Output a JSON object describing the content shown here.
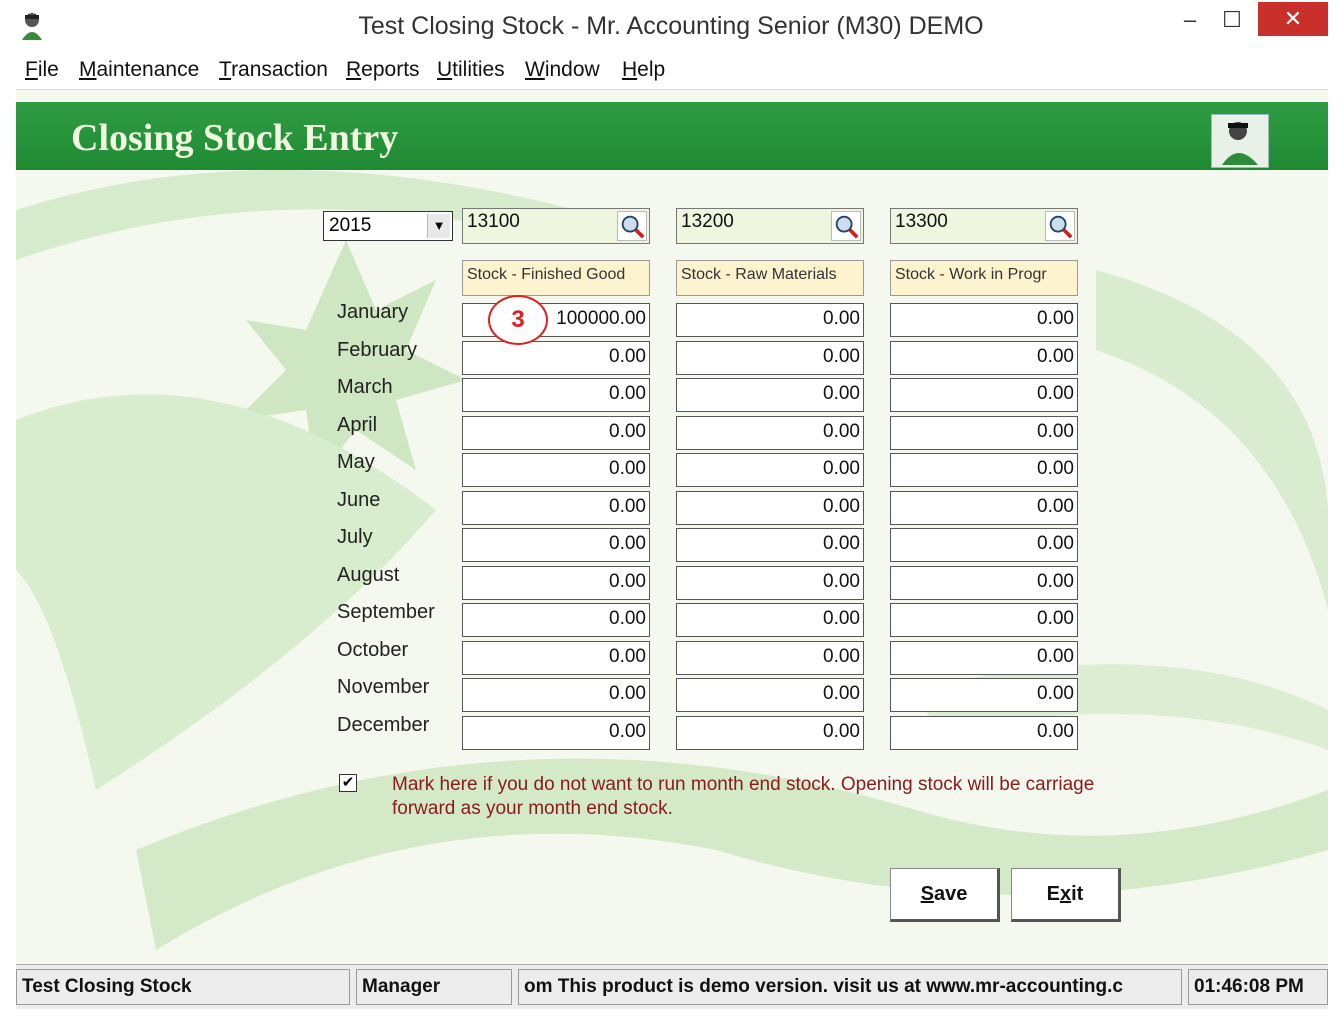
{
  "window": {
    "title": "Test Closing Stock - Mr. Accounting Senior (M30) DEMO",
    "minimize": "–",
    "maximize": "☐",
    "close": "✕"
  },
  "menu": [
    {
      "underline": "F",
      "rest": "ile"
    },
    {
      "underline": "M",
      "rest": "aintenance"
    },
    {
      "underline": "T",
      "rest": "ransaction"
    },
    {
      "underline": "R",
      "rest": "eports"
    },
    {
      "underline": "U",
      "rest": "tilities"
    },
    {
      "underline": "W",
      "rest": "indow"
    },
    {
      "underline": "H",
      "rest": "elp"
    }
  ],
  "banner": {
    "title": "Closing Stock Entry"
  },
  "year": "2015",
  "accounts": [
    {
      "code": "13100",
      "header": "Stock - Finished Good"
    },
    {
      "code": "13200",
      "header": "Stock - Raw Materials"
    },
    {
      "code": "13300",
      "header": "Stock - Work in Progr"
    }
  ],
  "months": [
    "January",
    "February",
    "March",
    "April",
    "May",
    "June",
    "July",
    "August",
    "September",
    "October",
    "November",
    "December"
  ],
  "values": [
    [
      "100000.00",
      "0.00",
      "0.00"
    ],
    [
      "0.00",
      "0.00",
      "0.00"
    ],
    [
      "0.00",
      "0.00",
      "0.00"
    ],
    [
      "0.00",
      "0.00",
      "0.00"
    ],
    [
      "0.00",
      "0.00",
      "0.00"
    ],
    [
      "0.00",
      "0.00",
      "0.00"
    ],
    [
      "0.00",
      "0.00",
      "0.00"
    ],
    [
      "0.00",
      "0.00",
      "0.00"
    ],
    [
      "0.00",
      "0.00",
      "0.00"
    ],
    [
      "0.00",
      "0.00",
      "0.00"
    ],
    [
      "0.00",
      "0.00",
      "0.00"
    ],
    [
      "0.00",
      "0.00",
      "0.00"
    ]
  ],
  "annotation": "3",
  "checkbox": {
    "checked": true,
    "mark": "✔",
    "text": "Mark here if you do not want to run month end stock.  Opening  stock  will  be  carriage  forward  as  your  month end stock."
  },
  "buttons": {
    "save": {
      "underline": "S",
      "rest": "ave"
    },
    "exit": {
      "pre": "E",
      "underline": "x",
      "rest": "it"
    }
  },
  "status": {
    "form": "Test Closing Stock",
    "user": "Manager",
    "message": "om This product is demo version.  visit us at www.mr-accounting.c",
    "time": "01:46:08 PM"
  }
}
